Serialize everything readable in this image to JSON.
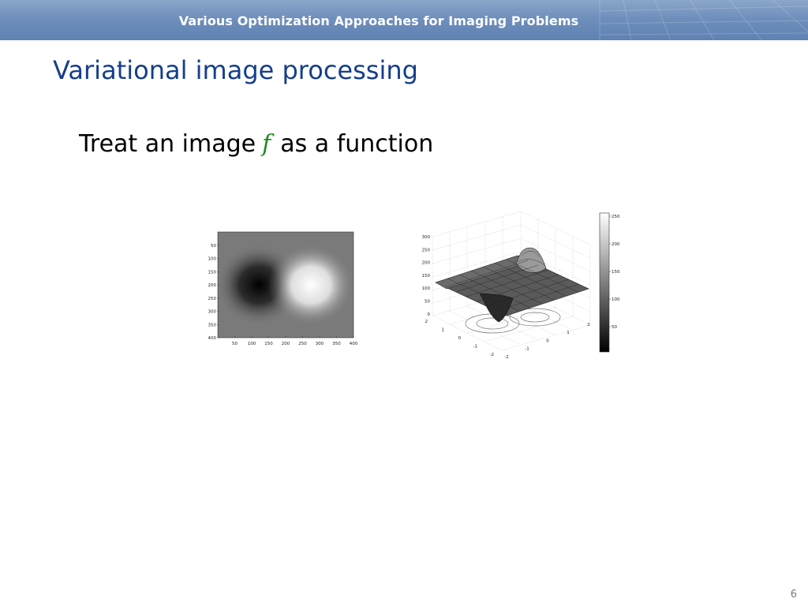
{
  "header": {
    "title": "Various Optimization Approaches for Imaging Problems"
  },
  "slide": {
    "title": "Variational image processing",
    "bullet": {
      "prefix": "Treat an image",
      "symbol": "f",
      "suffix": "as a function"
    },
    "page_number": "6"
  },
  "figure_image": {
    "y_ticks": [
      "50",
      "100",
      "150",
      "200",
      "250",
      "300",
      "350",
      "400"
    ],
    "x_ticks": [
      "50",
      "100",
      "150",
      "200",
      "250",
      "300",
      "350",
      "400"
    ]
  },
  "figure_surface": {
    "z_ticks": [
      "300",
      "250",
      "200",
      "150",
      "100",
      "50",
      "0"
    ],
    "y_ticks": [
      "2",
      "1",
      "0",
      "-1",
      "-2"
    ],
    "x_ticks": [
      "-2",
      "-1",
      "0",
      "1",
      "2"
    ],
    "colorbar_ticks": [
      "250",
      "200",
      "150",
      "100",
      "50"
    ]
  }
}
